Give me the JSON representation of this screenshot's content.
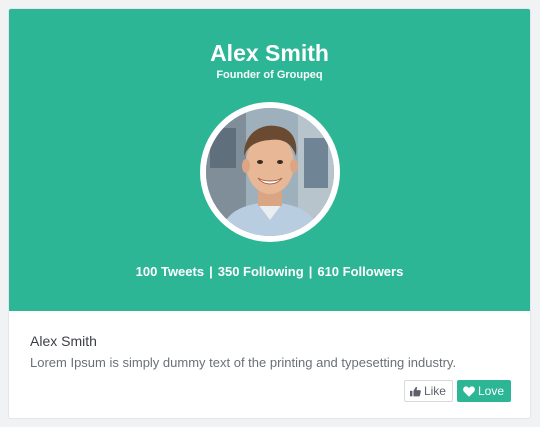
{
  "profile": {
    "name": "Alex Smith",
    "role": "Founder of Groupeq",
    "stats": {
      "tweets": "100 Tweets",
      "following": "350 Following",
      "followers": "610 Followers",
      "separator": "|"
    }
  },
  "details": {
    "title": "Alex Smith",
    "text": "Lorem Ipsum is simply dummy text of the printing and typesetting industry."
  },
  "actions": {
    "like_label": "Like",
    "love_label": "Love",
    "like_icon": "thumbs-up-icon",
    "love_icon": "heart-icon"
  },
  "colors": {
    "accent": "#2db696",
    "background": "#f1f2f4",
    "card": "#ffffff"
  }
}
